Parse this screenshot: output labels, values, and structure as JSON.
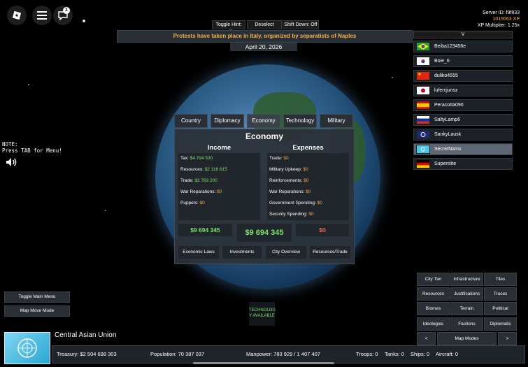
{
  "top_controls": {
    "toggle_hint": "Toggle Hint: Off",
    "deselect": "Deselect",
    "shift_down": "Shift Down: Off",
    "notification_count": "1"
  },
  "banner": "Protests have taken place in Italy, organized by separatists of Naples",
  "date": "April 20, 2026",
  "server": {
    "id": "Server ID: f9f833",
    "xp": "1019563 XP",
    "multiplier": "XP Multiplier: 1.25x"
  },
  "player_list": {
    "toggle": "V",
    "players": [
      {
        "name": "Beiba123456e",
        "flag": "brazil"
      },
      {
        "name": "Boie_6",
        "flag": "south-korea"
      },
      {
        "name": "duliko4555",
        "flag": "china"
      },
      {
        "name": "lufercjunsz",
        "flag": "japan"
      },
      {
        "name": "Peracotta090",
        "flag": "spain"
      },
      {
        "name": "SaltyLamp6",
        "flag": "russia"
      },
      {
        "name": "SankyLausk",
        "flag": "emblem"
      },
      {
        "name": "SecretNams",
        "flag": "central-asian-union",
        "selected": true
      },
      {
        "name": "Supersiite",
        "flag": "germany"
      }
    ]
  },
  "note": {
    "line1": "NOTE:",
    "line2": "Press TAB for Menu!"
  },
  "tabs": [
    "Country",
    "Diplomacy",
    "Economy",
    "Technology",
    "Military"
  ],
  "economy": {
    "title": "Economy",
    "income_title": "Income",
    "expenses_title": "Expenses",
    "income": [
      {
        "label": "Tax:",
        "value": "$4 794 530"
      },
      {
        "label": "Resources:",
        "value": "$2 116 615"
      },
      {
        "label": "Trade:",
        "value": "$2 783 200"
      },
      {
        "label": "War Reparations:",
        "value": "$0"
      },
      {
        "label": "Puppets:",
        "value": "$0"
      }
    ],
    "expenses": [
      {
        "label": "Trade:",
        "value": "$0"
      },
      {
        "label": "Military Upkeep:",
        "value": "$0"
      },
      {
        "label": "Reinforcements:",
        "value": "$0"
      },
      {
        "label": "War Reparations:",
        "value": "$0"
      },
      {
        "label": "Government Spending:",
        "value": "$0"
      },
      {
        "label": "Security Spending:",
        "value": "$0"
      }
    ],
    "income_total": "$9 694 345",
    "net_total": "$9 694 345",
    "expense_total": "$0",
    "buttons": [
      "Economic Laws",
      "Investments",
      "City Overview",
      "Resources/Trade"
    ]
  },
  "tech_notice": {
    "line1": "TECHNOLOG",
    "line2": "Y AVAILABLE"
  },
  "map_modes": {
    "buttons": [
      "City Tier",
      "Infrastructure",
      "Tiles",
      "Resources",
      "Justifications",
      "Truces",
      "Biomes",
      "Terrain",
      "Political",
      "Ideologies",
      "Factions",
      "Diplomatic"
    ],
    "prev": "<",
    "label": "Map Modes",
    "next": ">"
  },
  "left_buttons": {
    "toggle_menu": "Toggle Main Menu",
    "map_move": "Map Move Mode"
  },
  "country": {
    "name": "Central Asian Union"
  },
  "stats": {
    "treasury": "Treasury:  $2 504 698 303",
    "population": "Population: 70 387 037",
    "manpower": "Manpower:  783 929  /  1 407 407",
    "troops": "Troops: 0",
    "tanks": "Tanks: 0",
    "ships": "Ships: 0",
    "aircraft": "Aircraft: 0"
  },
  "colors": {
    "accent_orange": "#f0b04a",
    "money_green": "#7ee06a",
    "negative_red": "#e06a4a"
  }
}
